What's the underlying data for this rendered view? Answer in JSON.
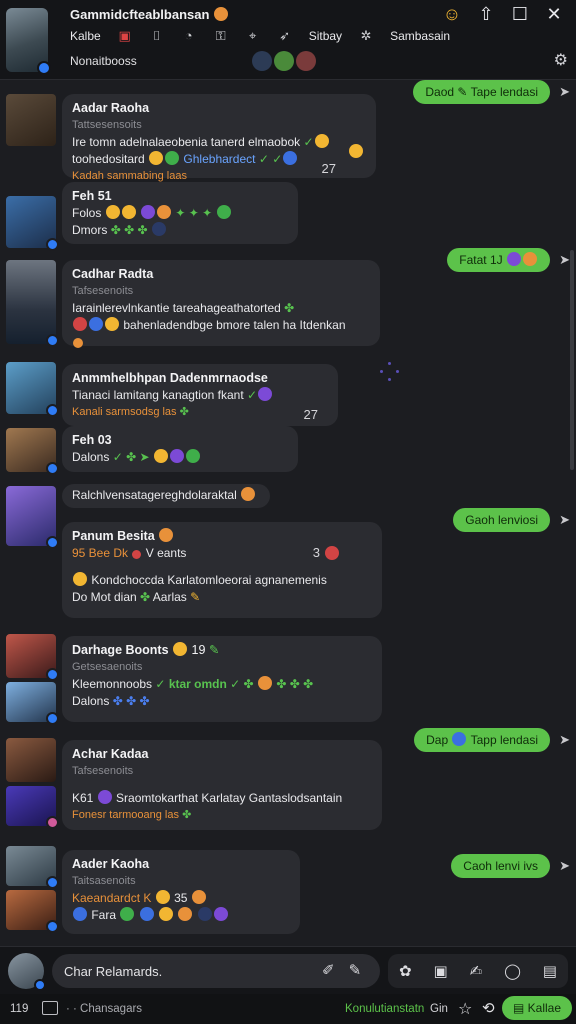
{
  "header": {
    "title": "Gammidcfteablbansan",
    "menu": [
      "Kalbe",
      "Sitbay",
      "Sambasain"
    ],
    "subtitle": "Nonaitbooss"
  },
  "messages": [
    {
      "name": "Aadar Raoha",
      "sub": "Tattsesensoits",
      "text1": "Ire tomn adelnalaeobenia tanerd elmaobok",
      "text2": "toohedositard",
      "link": "Ghlebhardect",
      "footer": "Kadah  sammabing laas",
      "count": "27"
    },
    {
      "name": "Feh 51",
      "sub": "Folos",
      "text2": "Dmors"
    },
    {
      "name": "Cadhar Radta",
      "sub": "Tafsesenoits",
      "text1": "Iarainlerevlnkantie tareahageathatorted",
      "text2": "bahenladendbge bmore talen ha Itdenkan"
    },
    {
      "name": "Anmmhelbhpan Dadenmrnaodse",
      "text1": "Tianaci lamitang kanagtion fkant",
      "footer": "Kanali  sarmsodsg las",
      "count": "27"
    },
    {
      "name": "Feh 03",
      "sub": "Dalons"
    },
    {
      "name": "Ralchlvensatagereghdolaraktal"
    },
    {
      "name": "Panum Besita",
      "text1": "95 Bee  Dk",
      "text1b": "V eants",
      "count": "3",
      "text2": "Kondchoccda Karlatomloeorai agnanemenis",
      "text3": "Do Mot dian",
      "text3b": "Aarlas"
    },
    {
      "name": "Darhage Boonts",
      "sub_num": "19",
      "sub": "Getsesaenoits",
      "text1": "Kleemonnoobs",
      "text1b": "ktar omdn",
      "text2": "Dalons"
    },
    {
      "name": "Achar Kadaa",
      "sub": "Tafsesenoits",
      "text1": "Sraomtokarthat Karlatay Gantaslodsantain",
      "text1a": "K61",
      "footer": "Fonesr  tarmooang las"
    },
    {
      "name": "Aader Kaoha",
      "sub": "Taitsasenoits",
      "text1": "Kaeandardct K",
      "text1b": "35",
      "text2": "Fara"
    }
  ],
  "outgoing": [
    {
      "text": "Daod",
      "text2": "Tape",
      "text3": "lendasi"
    },
    {
      "text": "Fatat 1J"
    },
    {
      "text": "Gaoh",
      "text2": "lenviosi"
    },
    {
      "text": "Dap",
      "text2": "Tapp",
      "text3": "lendasi"
    },
    {
      "text": "Caoh",
      "text2": "lenvi ivs"
    }
  ],
  "composer": {
    "placeholder": "Char Relamards."
  },
  "status": {
    "left": "119",
    "channels": "· · Chansagars",
    "green": "Konulutianstatn",
    "gin": "Gin",
    "button": "Kallae"
  },
  "colors": {
    "background": "#1c1d21",
    "bubble": "#2b2c31",
    "accent_green": "#5cc24a",
    "accent_orange": "#e8913a",
    "verified_blue": "#2f7cf6"
  }
}
